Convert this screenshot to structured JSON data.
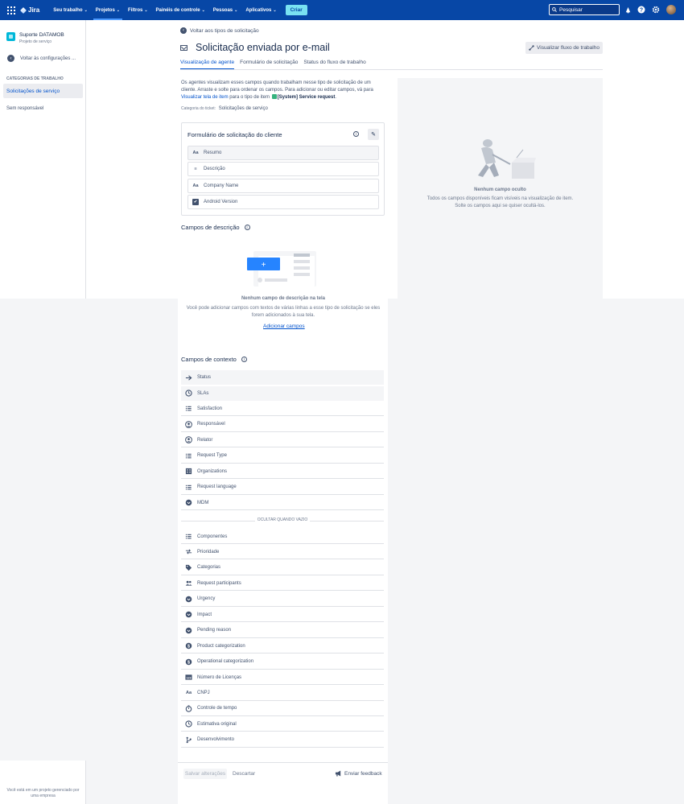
{
  "topnav": {
    "logo": "Jira",
    "menu": [
      {
        "label": "Seu trabalho",
        "active": false
      },
      {
        "label": "Projetos",
        "active": true
      },
      {
        "label": "Filtros",
        "active": false
      },
      {
        "label": "Painéis de controle",
        "active": false
      },
      {
        "label": "Pessoas",
        "active": false
      },
      {
        "label": "Aplicativos",
        "active": false
      }
    ],
    "create_label": "Criar",
    "search_placeholder": "Pesquisar"
  },
  "sidebar": {
    "project_name": "Suporte DATAMOB",
    "project_type": "Projeto de serviço",
    "back_label": "Voltar às configurações ...",
    "section_heading": "CATEGORIAS DE TRABALHO",
    "selected_item": "Solicitações de serviço",
    "unassigned": "Sem responsável",
    "footer": "Você está em um projeto gerenciado por uma empresa"
  },
  "header": {
    "back_link": "Voltar aos tipos de solicitação",
    "title": "Solicitação enviada por e-mail",
    "workflow_button": "Visualizar fluxo de trabalho",
    "tabs": [
      {
        "label": "Visualização de agente",
        "active": true
      },
      {
        "label": "Formulário de solicitação",
        "active": false
      },
      {
        "label": "Status do fluxo de trabalho",
        "active": false
      }
    ]
  },
  "intro": {
    "text1": "Os agentes visualizam esses campos quando trabalham nesse tipo de solicitação de um cliente. Arraste e solte para ordenar os campos. Para adicionar ou editar campos, vá para",
    "link": "Visualizar tela de item",
    "text2": "para o tipo de item",
    "issue_type": "[System] Service request",
    "ticket_category_label": "Categoria do ticket:",
    "ticket_category_value": "Solicitações de serviço"
  },
  "form": {
    "title": "Formulário de solicitação do cliente",
    "fields": [
      {
        "icon": "Aa",
        "label": "Resumo",
        "grey": true
      },
      {
        "icon": "≡",
        "label": "Descrição",
        "grey": false
      },
      {
        "icon": "Aa",
        "label": "Company Name",
        "grey": false
      },
      {
        "icon": "✔",
        "label": "Android Version",
        "grey": false
      }
    ]
  },
  "description_fields": {
    "title": "Campos de descrição",
    "empty_title": "Nenhum campo de descrição na tela",
    "empty_text": "Você pode adicionar campos com textos de várias linhas a esse tipo de solicitação se eles forem adicionados à sua tela.",
    "add_link": "Adicionar campos"
  },
  "context_fields": {
    "title": "Campos de contexto",
    "visible": [
      {
        "icon": "arrow",
        "label": "Status",
        "grey": true
      },
      {
        "icon": "clock",
        "label": "SLAs",
        "grey": true
      },
      {
        "icon": "list",
        "label": "Satisfaction",
        "grey": false
      },
      {
        "icon": "user",
        "label": "Responsável",
        "grey": false
      },
      {
        "icon": "user",
        "label": "Relator",
        "grey": false
      },
      {
        "icon": "list",
        "label": "Request Type",
        "grey": false
      },
      {
        "icon": "building",
        "label": "Organizations",
        "grey": false
      },
      {
        "icon": "list",
        "label": "Request language",
        "grey": false
      },
      {
        "icon": "dot",
        "label": "MDM",
        "grey": false
      }
    ],
    "divider_label": "OCULTAR QUANDO VAZIO",
    "hidden": [
      {
        "icon": "list",
        "label": "Componentes"
      },
      {
        "icon": "swap",
        "label": "Prioridade"
      },
      {
        "icon": "tag",
        "label": "Categorias"
      },
      {
        "icon": "users",
        "label": "Request participants"
      },
      {
        "icon": "dot",
        "label": "Urgency"
      },
      {
        "icon": "dot",
        "label": "Impact"
      },
      {
        "icon": "dot",
        "label": "Pending reason"
      },
      {
        "icon": "dollar",
        "label": "Product categorization"
      },
      {
        "icon": "dollar",
        "label": "Operational categorization"
      },
      {
        "icon": "number",
        "label": "Número de Licenças"
      },
      {
        "icon": "Aa",
        "label": "CNPJ"
      },
      {
        "icon": "stopwatch",
        "label": "Controle de tempo"
      },
      {
        "icon": "clock",
        "label": "Estimativa original"
      },
      {
        "icon": "branch",
        "label": "Desenvolvimento"
      }
    ]
  },
  "hidden_panel": {
    "empty_title": "Nenhum campo oculto",
    "empty_text": "Todos os campos disponíveis ficam visíveis na visualização de item. Solte os campos aqui se quiser ocultá-los."
  },
  "footer": {
    "save": "Salvar alterações",
    "discard": "Descartar",
    "feedback": "Enviar feedback"
  },
  "colors": {
    "nav": "#0747a6",
    "link": "#0052cc",
    "create": "#79e2f2"
  }
}
